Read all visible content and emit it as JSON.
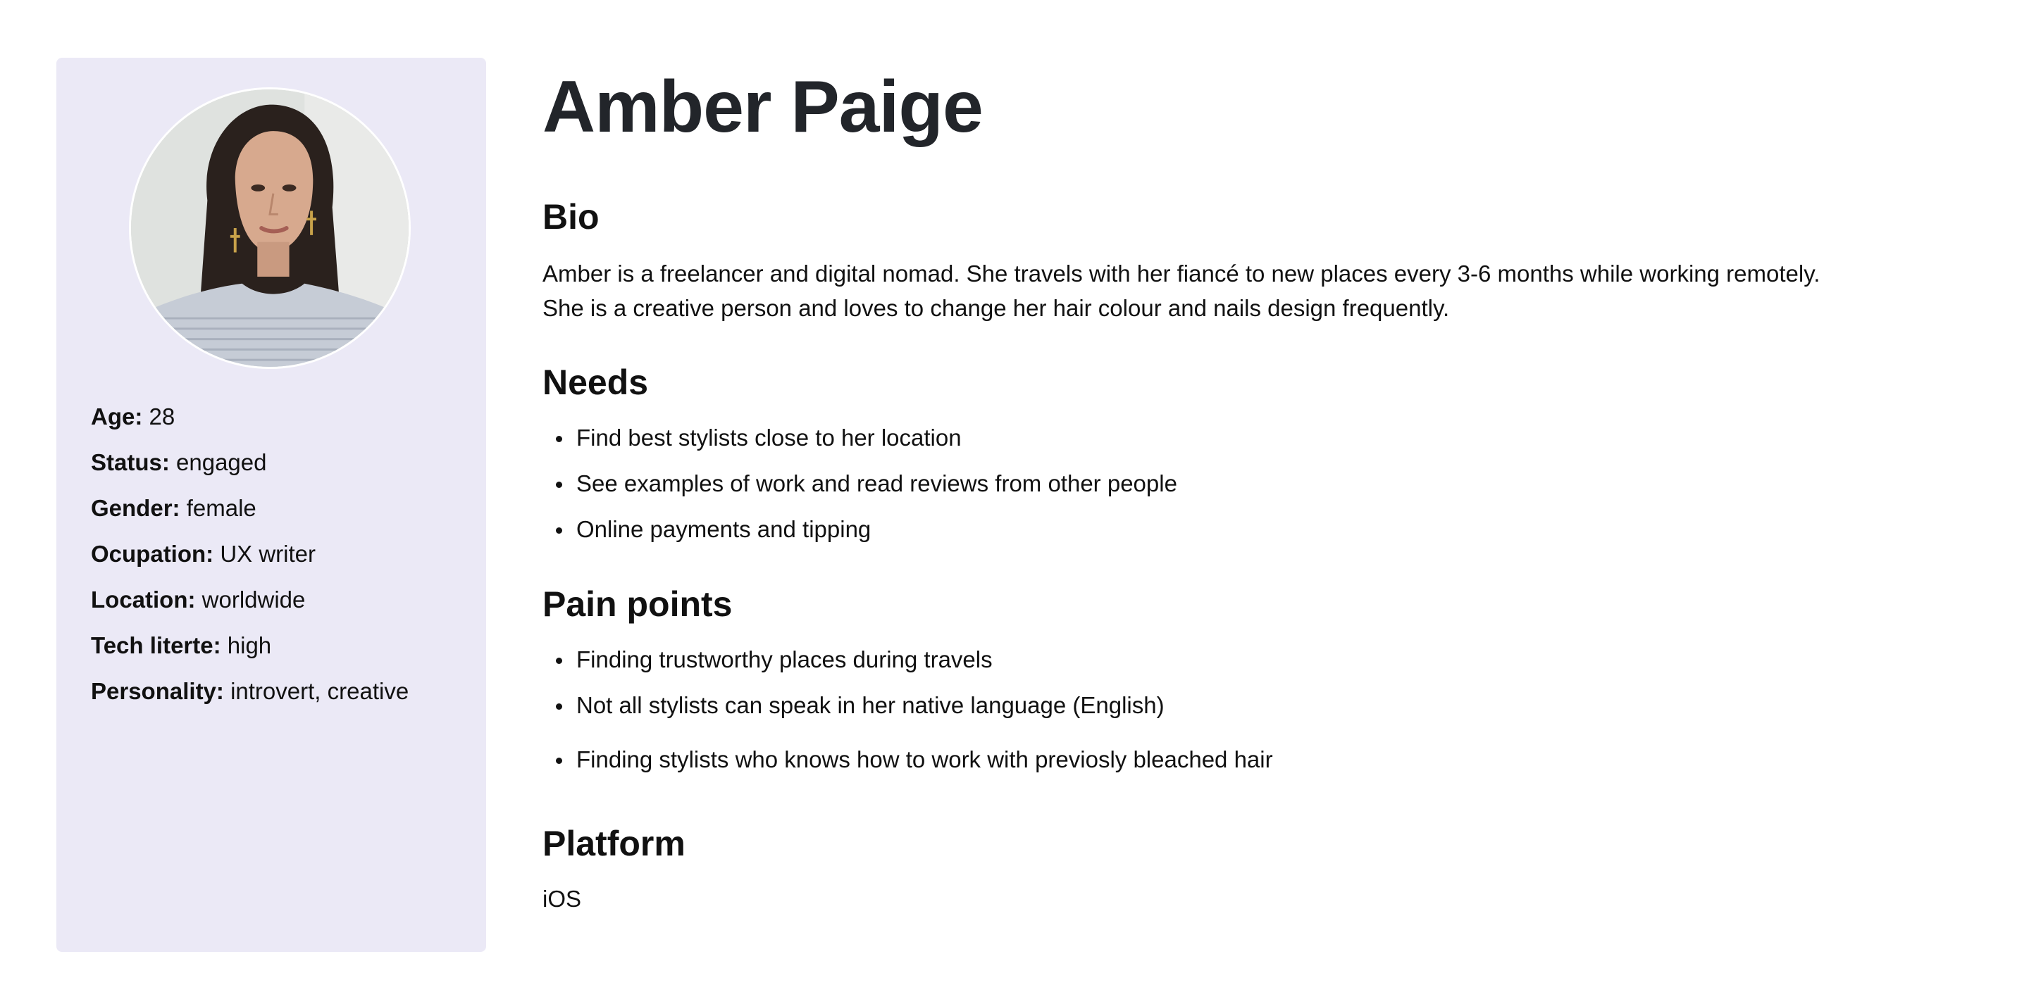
{
  "persona": {
    "name": "Amber Paige",
    "photo_alt": "Portrait of Amber Paige",
    "facts": [
      {
        "label": "Age:",
        "value": "28"
      },
      {
        "label": "Status:",
        "value": "engaged"
      },
      {
        "label": "Gender:",
        "value": "female"
      },
      {
        "label": "Ocupation:",
        "value": "UX writer"
      },
      {
        "label": "Location:",
        "value": "worldwide"
      },
      {
        "label": "Tech literte:",
        "value": "high"
      },
      {
        "label": "Personality:",
        "value": "introvert, creative"
      }
    ]
  },
  "sections": {
    "bio": {
      "title": "Bio",
      "lines": [
        "Amber is a freelancer and digital nomad. She travels with her fiancé to new places every 3-6 months while working remotely.",
        "She is a creative person and loves to change her hair colour and nails design frequently."
      ]
    },
    "needs": {
      "title": "Needs",
      "items": [
        "Find best stylists close to her location",
        "See examples of work and read reviews from other people",
        "Online payments and tipping"
      ]
    },
    "pain_points": {
      "title": "Pain points",
      "items": [
        "Finding trustworthy places during travels",
        "Not all stylists can speak in her native language (English)",
        "Finding stylists who knows how to work with previosly bleached hair"
      ]
    },
    "platform": {
      "title": "Platform",
      "value": "iOS"
    }
  },
  "colors": {
    "sidebar_background": "#ebe9f6",
    "title_text": "#22252a",
    "body_text": "#111111"
  }
}
